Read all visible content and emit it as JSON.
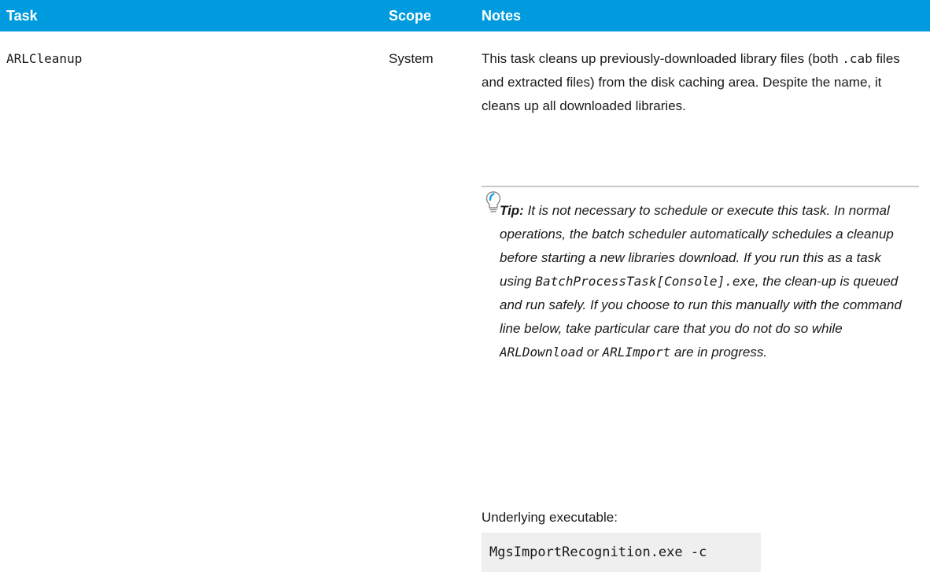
{
  "table": {
    "headers": {
      "task": "Task",
      "scope": "Scope",
      "notes": "Notes"
    },
    "row": {
      "task": "ARLCleanup",
      "scope": "System",
      "notes": {
        "part1": "This task cleans up previously-downloaded library files (both ",
        "code1": ".cab",
        "part2": " files and extracted files) from the disk caching area. Despite the name, it cleans up all downloaded libraries."
      },
      "tip": {
        "icon": "lightbulb-icon",
        "label": "Tip:",
        "text1": " It is not necessary to schedule or execute this task. In normal operations, the batch scheduler automatically schedules a cleanup before starting a new libraries download. If you run this as a task using ",
        "code1": "BatchProcessTask[Console].exe",
        "text2": ", the clean-up is queued and run safely. If you choose to run this manually with the command line below, take particular care that you do not do so while ",
        "code2": "ARLDownload",
        "text3": " or ",
        "code3": "ARLImport",
        "text4": " are in progress."
      },
      "underlying_label": "Underlying executable:",
      "command": "MgsImportRecognition.exe -c"
    }
  },
  "colors": {
    "header_bg": "#009ade",
    "code_bg": "#efefef"
  }
}
